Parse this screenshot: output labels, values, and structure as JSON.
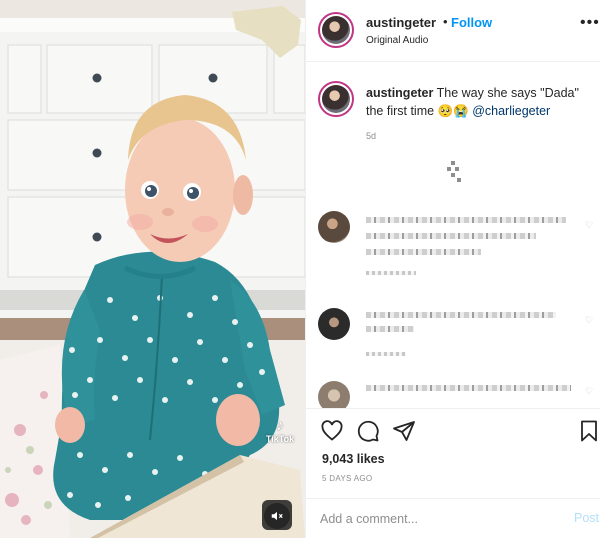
{
  "header": {
    "username": "austingeter",
    "separator": "•",
    "follow_label": "Follow",
    "audio_label": "Original Audio",
    "more_icon": "more-horizontal-icon"
  },
  "caption": {
    "username": "austingeter",
    "text": "The way she says \"Dada\" the first time",
    "emojis": "🥺😭",
    "mention": "@charliegeter",
    "time": "5d"
  },
  "media": {
    "watermark_brand": "TikTok",
    "mute_icon": "speaker-muted-icon"
  },
  "actions": {
    "like_icon": "heart-icon",
    "comment_icon": "comment-icon",
    "share_icon": "paper-plane-icon",
    "save_icon": "bookmark-icon"
  },
  "likes": "9,043 likes",
  "post_date": "5 DAYS AGO",
  "add_comment": {
    "placeholder": "Add a comment...",
    "post_label": "Post"
  },
  "colors": {
    "follow_blue": "#0095f6",
    "story_ring": "#c13584",
    "post_disabled": "#b2dffc",
    "muted_text": "#8e8e8e",
    "onesie_teal": "#2b8a93"
  }
}
